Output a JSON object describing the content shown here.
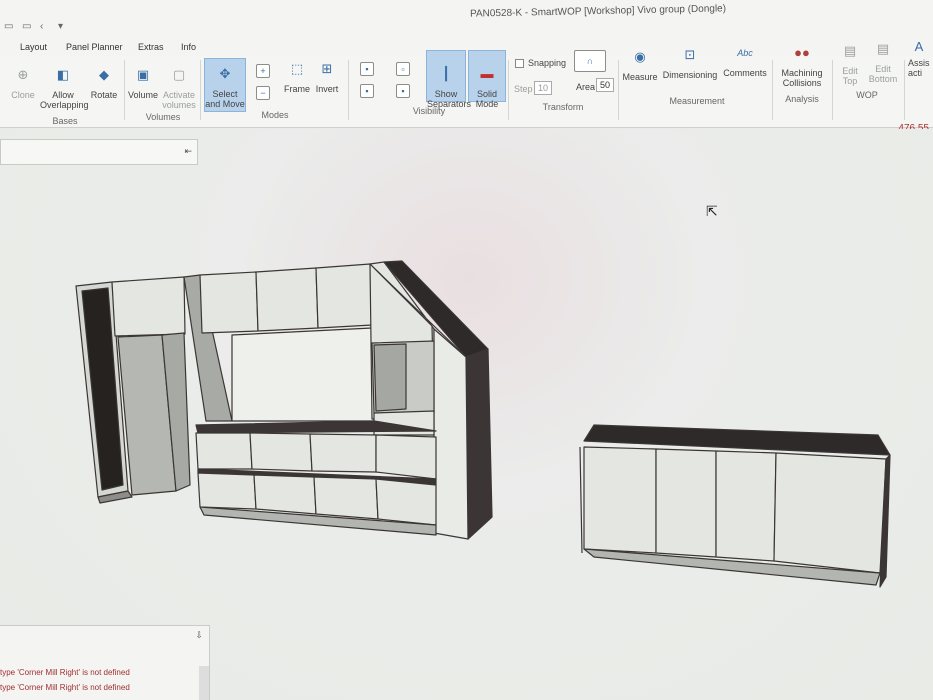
{
  "window": {
    "title": "PAN0528-K - SmartWOP [Workshop] Vivo group (Dongle)"
  },
  "menu": {
    "tabs": [
      "Layout",
      "Panel Planner",
      "Extras",
      "Info"
    ]
  },
  "ribbon": {
    "bases": {
      "clone": "Clone",
      "allow_overlapping": "Allow Overlapping",
      "rotate": "Rotate",
      "label": "Bases"
    },
    "volumes": {
      "volume": "Volume",
      "activate_volumes": "Activate volumes",
      "label": "Volumes"
    },
    "modes": {
      "select_and_move": "Select and Move",
      "frame": "Frame",
      "invert": "Invert",
      "label": "Modes"
    },
    "visibility": {
      "show_separators": "Show Separators",
      "solid_mode": "Solid Mode",
      "label": "Visibility"
    },
    "transform": {
      "snapping": "Snapping",
      "step_label": "Step",
      "step_value": "10",
      "area_label": "Area",
      "area_value": "50",
      "label": "Transform"
    },
    "measurement": {
      "measure": "Measure",
      "dimensioning": "Dimensioning",
      "comments": "Comments",
      "label": "Measurement"
    },
    "analysis": {
      "machining_collisions": "Machining Collisions",
      "label": "Analysis"
    },
    "wop": {
      "edit_top": "Edit Top",
      "edit_bottom": "Edit Bottom",
      "label": "WOP"
    },
    "assist": {
      "label_line1": "Assis",
      "label_line2": "acti"
    }
  },
  "status": {
    "coordinate": "476,55"
  },
  "log": {
    "lines": [
      "type 'Corner Mill Right' is not defined",
      "type 'Corner Mill Right' is not defined"
    ]
  },
  "colors": {
    "accent": "#3a6ea5",
    "selected": "#b8d2ec",
    "error_text": "#a03030",
    "panel_face": "#e4e6e2",
    "panel_dark": "#3b3635"
  }
}
